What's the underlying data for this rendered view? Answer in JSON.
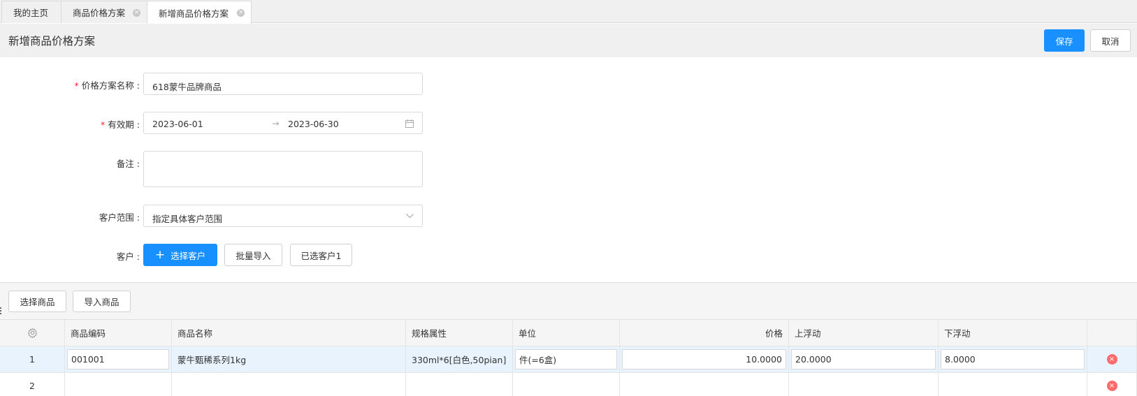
{
  "tabs": [
    {
      "label": "我的主页"
    },
    {
      "label": "商品价格方案"
    },
    {
      "label": "新增商品价格方案"
    }
  ],
  "header": {
    "title": "新增商品价格方案",
    "save_label": "保存",
    "cancel_label": "取消"
  },
  "form": {
    "name_label": "价格方案名称",
    "name_value": "618蒙牛品牌商品",
    "validity_label": "有效期",
    "date_start": "2023-06-01",
    "date_arrow": "→",
    "date_end": "2023-06-30",
    "remark_label": "备注",
    "remark_value": "",
    "scope_label": "客户范围",
    "scope_value": "指定具体客户范围",
    "customer_label": "客户",
    "select_customer_label": "选择客户",
    "batch_import_label": "批量导入",
    "selected_customers_label": "已选客户1"
  },
  "toolbar": {
    "select_goods_label": "选择商品",
    "import_goods_label": "导入商品"
  },
  "table": {
    "columns": [
      "",
      "商品编码",
      "商品名称",
      "规格属性",
      "单位",
      "价格",
      "上浮动",
      "下浮动",
      ""
    ],
    "rows": [
      {
        "index": "1",
        "code": "001001",
        "name": "蒙牛甄稀系列1kg",
        "spec": "330ml*6[白色,50pian]",
        "unit": "件(=6盒)",
        "price": "10.0000",
        "up": "20.0000",
        "down": "8.0000"
      },
      {
        "index": "2",
        "code": "",
        "name": "",
        "spec": "",
        "unit": "",
        "price": "",
        "up": "",
        "down": ""
      }
    ]
  },
  "colors": {
    "primary": "#1890ff",
    "required": "#f5222d",
    "delete": "#ff6b6b",
    "selected_row": "#e9f3fd"
  }
}
